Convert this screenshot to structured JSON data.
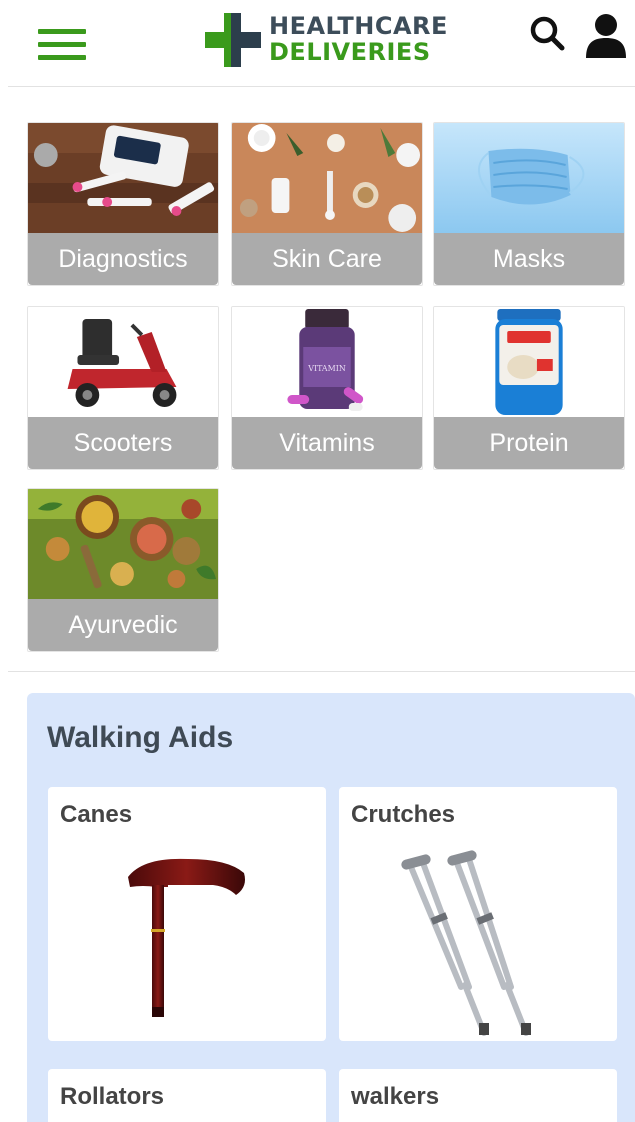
{
  "header": {
    "menu_icon": "hamburger-menu-icon",
    "logo": {
      "line1": "HEALTHCARE",
      "line2": "DELIVERIES",
      "icon": "green-cross-icon"
    },
    "search_icon": "search-icon",
    "user_icon": "user-icon"
  },
  "categories": [
    {
      "label": "Diagnostics",
      "icon": "glucose-meter-image"
    },
    {
      "label": "Skin Care",
      "icon": "skin-care-products-image"
    },
    {
      "label": "Masks",
      "icon": "face-mask-image"
    },
    {
      "label": "Scooters",
      "icon": "mobility-scooter-image"
    },
    {
      "label": "Vitamins",
      "icon": "vitamin-bottle-image"
    },
    {
      "label": "Protein",
      "icon": "protein-tub-image"
    },
    {
      "label": "Ayurvedic",
      "icon": "ayurvedic-herbs-image"
    }
  ],
  "walking_aids": {
    "title": "Walking Aids",
    "items": [
      {
        "label": "Canes",
        "icon": "cane-image"
      },
      {
        "label": "Crutches",
        "icon": "crutches-image"
      },
      {
        "label": "Rollators",
        "icon": "rollator-image"
      },
      {
        "label": "walkers",
        "icon": "walker-image"
      }
    ]
  },
  "colors": {
    "brand_green": "#3a9a1c",
    "brand_dark": "#3d4d5a",
    "tile_label_bg": "#ababab",
    "section_bg": "#d9e6fb"
  }
}
